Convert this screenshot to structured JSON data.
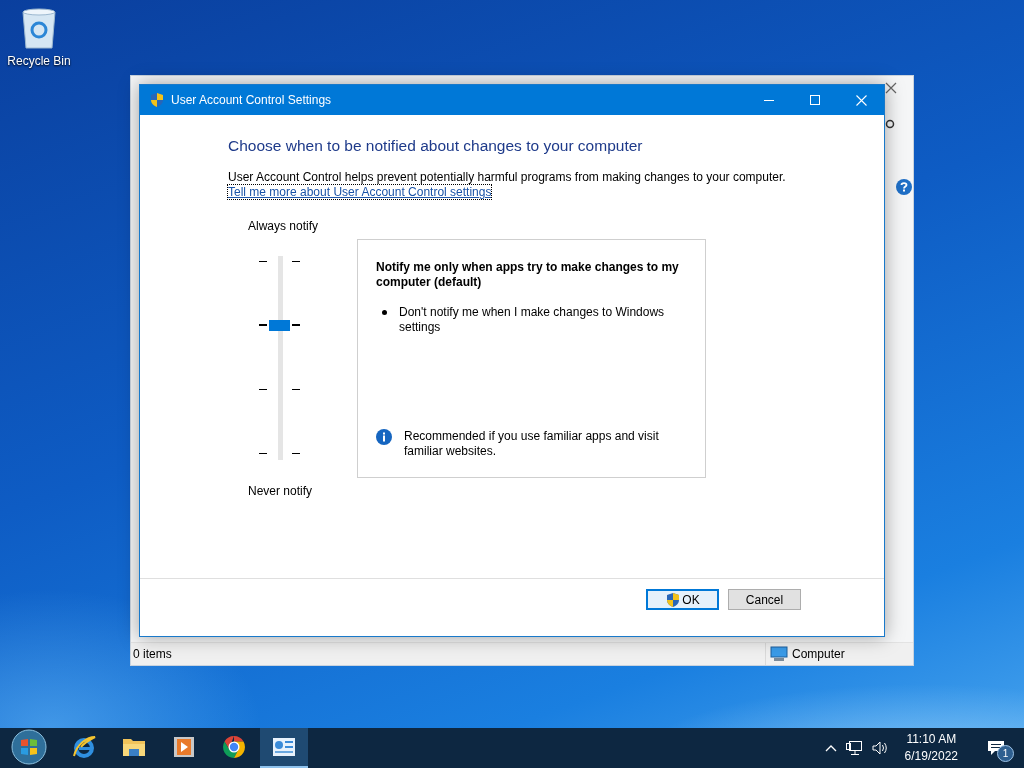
{
  "desktop_icons": [
    {
      "label": "Recycle Bin"
    }
  ],
  "background_window": {
    "status_bar": {
      "items": "0 items",
      "location": "Computer"
    }
  },
  "dialog": {
    "title": "User Account Control Settings",
    "heading": "Choose when to be notified about changes to your computer",
    "description": "User Account Control helps prevent potentially harmful programs from making changes to your computer.",
    "link": "Tell me more about User Account Control settings",
    "slider": {
      "top_label": "Always notify",
      "bottom_label": "Never notify",
      "level": 0.667
    },
    "info": {
      "title": "Notify me only when apps try to make changes to my computer (default)",
      "bullets": [
        "Don't notify me when I make changes to Windows settings"
      ],
      "recommendation": "Recommended if you use familiar apps and visit familiar websites."
    },
    "buttons": [
      {
        "label": "OK",
        "kind": "shield",
        "default": true
      },
      {
        "label": "Cancel",
        "kind": "plain",
        "default": false
      }
    ]
  },
  "taskbar": {
    "apps": [
      {
        "kind": "ie",
        "selected": false
      },
      {
        "kind": "folder",
        "selected": false
      },
      {
        "kind": "media",
        "selected": false
      },
      {
        "kind": "chrome",
        "selected": false
      },
      {
        "kind": "uac",
        "selected": true
      }
    ],
    "time": "11:10 AM",
    "date": "6/19/2022",
    "notifications": "1"
  }
}
